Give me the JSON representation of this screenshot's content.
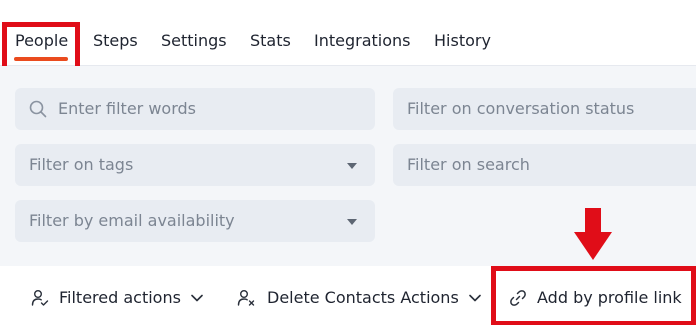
{
  "tabs": [
    {
      "label": "People",
      "active": true
    },
    {
      "label": "Steps"
    },
    {
      "label": "Settings"
    },
    {
      "label": "Stats"
    },
    {
      "label": "Integrations"
    },
    {
      "label": "History"
    }
  ],
  "filters": {
    "search_placeholder": "Enter filter words",
    "status_placeholder": "Filter on conversation status",
    "tags_placeholder": "Filter on tags",
    "search_filter_placeholder": "Filter on search",
    "email_placeholder": "Filter by email availability"
  },
  "actions": {
    "filtered": "Filtered actions",
    "delete": "Delete Contacts Actions",
    "add_profile": "Add by profile link"
  },
  "colors": {
    "accent": "#ea4b1e",
    "annotation": "#e00d18",
    "field_bg": "#e8ecf2",
    "panel_bg": "#f4f6f9"
  }
}
